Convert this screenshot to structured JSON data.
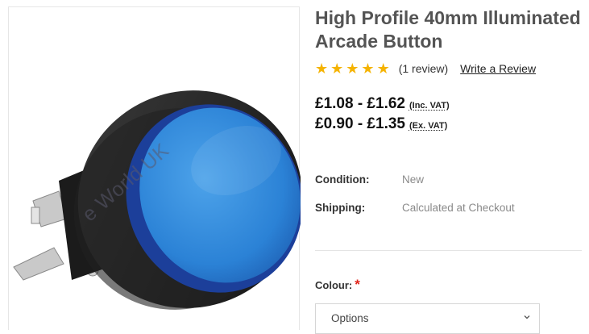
{
  "product": {
    "title_line1": "High Profile 40mm Illuminated",
    "title_line2": "Arcade Button",
    "image_alt": "Blue high profile 40mm illuminated arcade button",
    "watermark_text": "© Arcade World UK",
    "watermark_visible": "e World UK",
    "color_accent": "#2a7fd4"
  },
  "rating": {
    "stars": 5,
    "star_color": "#f5b301",
    "review_count_text": "(1 review)",
    "write_review_label": "Write a Review"
  },
  "pricing": {
    "inc_vat_price": "£1.08 - £1.62",
    "inc_vat_label": "(Inc. VAT)",
    "ex_vat_price": "£0.90 - £1.35",
    "ex_vat_label": "(Ex. VAT)"
  },
  "specs": {
    "condition_label": "Condition:",
    "condition_value": "New",
    "shipping_label": "Shipping:",
    "shipping_value": "Calculated at Checkout"
  },
  "options": {
    "colour_label": "Colour:",
    "required_mark": "*",
    "select_value": "Options",
    "required_color": "#e1261c"
  }
}
